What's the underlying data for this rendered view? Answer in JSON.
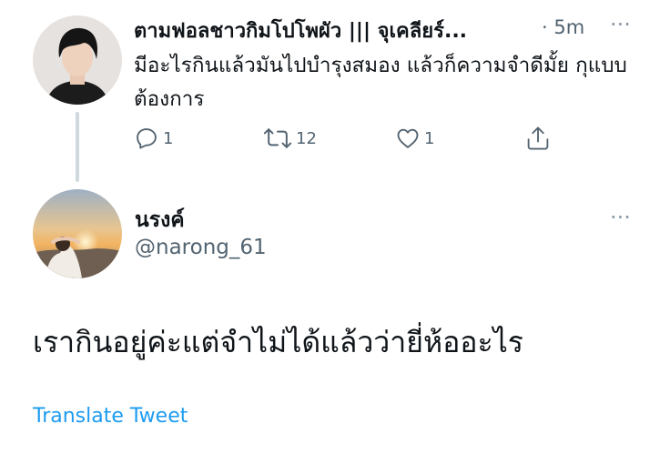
{
  "tweet1": {
    "author_name": "ตามฟอลชาวกิมโปโพผัว ||| จุเคลียร์...",
    "time": "· 5m",
    "text": "มีอะไรกินแล้วมันไปบำรุงสมอง แล้วก็ความจำดีมั้ย กุแบบต้องการ",
    "actions": {
      "reply_count": "1",
      "retweet_count": "12",
      "like_count": "1"
    },
    "more_label": "···"
  },
  "tweet2": {
    "author_name": "นรงค์",
    "handle": "@narong_61",
    "text": "เรากินอยู่ค่ะแต่จำไม่ได้แล้วว่ายี่ห้ออะไร",
    "translate_label": "Translate Tweet",
    "more_label": "···"
  },
  "icons": {
    "reply": "reply-icon",
    "retweet": "retweet-icon",
    "like": "heart-icon",
    "share": "share-icon",
    "more": "more-options-icon"
  },
  "colors": {
    "text_primary": "#0f1419",
    "text_secondary": "#536471",
    "link": "#1d9bf0",
    "thread_line": "#cfd9de"
  }
}
